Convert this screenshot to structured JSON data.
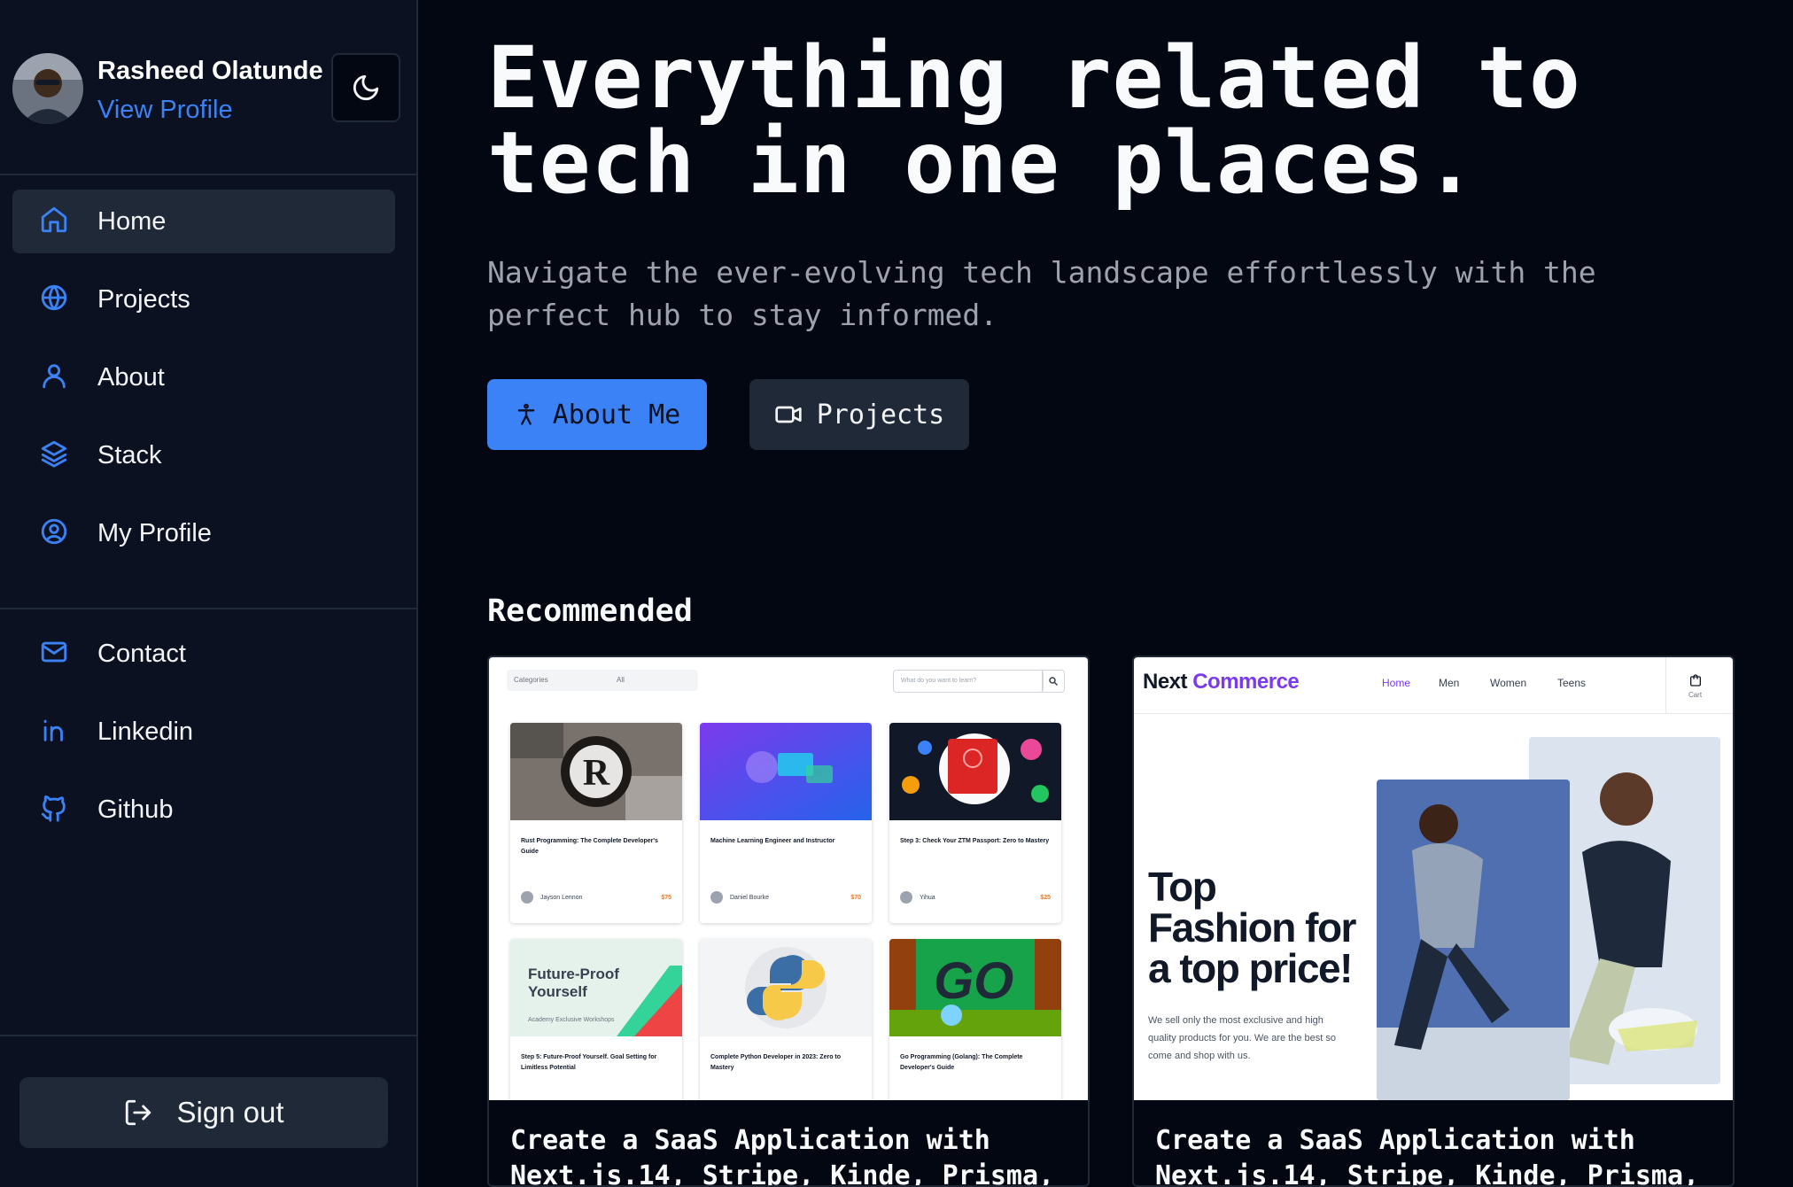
{
  "sidebar": {
    "profile": {
      "name": "Rasheed Olatunde",
      "link": "View Profile"
    },
    "primary_nav": [
      {
        "label": "Home",
        "icon": "home-icon",
        "active": true
      },
      {
        "label": "Projects",
        "icon": "globe-icon",
        "active": false
      },
      {
        "label": "About",
        "icon": "user-icon",
        "active": false
      },
      {
        "label": "Stack",
        "icon": "layers-icon",
        "active": false
      },
      {
        "label": "My Profile",
        "icon": "user-circle-icon",
        "active": false
      }
    ],
    "secondary_nav": [
      {
        "label": "Contact",
        "icon": "mail-icon"
      },
      {
        "label": "Linkedin",
        "icon": "linkedin-icon"
      },
      {
        "label": "Github",
        "icon": "github-icon"
      }
    ],
    "sign_out": "Sign out"
  },
  "hero": {
    "title": "Everything related to tech in one places.",
    "subtitle": "Navigate the ever-evolving tech landscape effortlessly with the perfect hub to stay informed.",
    "primary_button": "About Me",
    "secondary_button": "Projects"
  },
  "recommended": {
    "heading": "Recommended",
    "cards": [
      {
        "title": "Create a SaaS Application with Next.js.14, Stripe, Kinde, Prisma,",
        "thumb": {
          "select_1": "Categories",
          "select_2": "All",
          "search_placeholder": "What do you want to learn?",
          "courses": [
            {
              "name": "Rust Programming: The Complete Developer's Guide",
              "author": "Jayson Lennon",
              "price": "$75"
            },
            {
              "name": "Machine Learning Engineer and Instructor",
              "author": "Daniel Bourke",
              "price": "$70"
            },
            {
              "name": "Step 3: Check Your ZTM Passport: Zero to Mastery",
              "author": "Yihua",
              "price": "$25"
            },
            {
              "name": "Step 5: Future-Proof Yourself. Goal Setting for Limitless Potential",
              "author": "",
              "price": ""
            },
            {
              "name": "Complete Python Developer in 2023: Zero to Mastery",
              "author": "",
              "price": ""
            },
            {
              "name": "Go Programming (Golang): The Complete Developer's Guide",
              "author": "",
              "price": ""
            }
          ],
          "future_proof_heading": "Future-Proof Yourself",
          "future_proof_caption": "Academy Exclusive Workshops",
          "go_logo": "GO"
        }
      },
      {
        "title": "Create a SaaS Application with Next.js.14, Stripe, Kinde, Prisma,",
        "thumb": {
          "logo_a": "Next",
          "logo_b": "Commerce",
          "nav": [
            "Home",
            "Men",
            "Women",
            "Teens"
          ],
          "cart": "Cart",
          "headline": "Top Fashion for a top price!",
          "description": "We sell only the most exclusive and high quality products for you. We are the best so come and shop with us."
        }
      }
    ]
  },
  "colors": {
    "accent": "#3b82f6",
    "background": "#030712",
    "sidebar": "#0b1120",
    "surface": "#1f2937"
  }
}
